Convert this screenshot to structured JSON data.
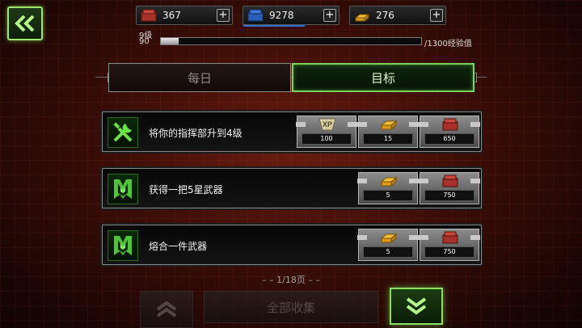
{
  "resources": [
    {
      "name": "red-crate",
      "value": "367",
      "color": "#c0392b"
    },
    {
      "name": "blue-crate",
      "value": "9278",
      "color": "#2e6fd6"
    },
    {
      "name": "gold-bars",
      "value": "276",
      "color": "#e3a41a"
    }
  ],
  "player": {
    "level_label": "9级",
    "xp_current": "90",
    "xp_max_label": "/1300经验值",
    "xp_progress": 0.069
  },
  "tabs": [
    {
      "label": "每日",
      "active": false
    },
    {
      "label": "目标",
      "active": true
    }
  ],
  "quests": [
    {
      "title": "将你的指挥部升到4级",
      "icon": "wrench-screwdriver-icon",
      "rewards": [
        {
          "type": "xp",
          "label": "XP",
          "value": "100"
        },
        {
          "type": "gold",
          "value": "15"
        },
        {
          "type": "red-crate",
          "value": "650"
        }
      ]
    },
    {
      "title": "获得一把5星武器",
      "icon": "medal-icon",
      "rewards": [
        {
          "type": "gold",
          "value": "5"
        },
        {
          "type": "red-crate",
          "value": "750"
        }
      ]
    },
    {
      "title": "熔合一件武器",
      "icon": "medal-icon",
      "rewards": [
        {
          "type": "gold",
          "value": "5"
        },
        {
          "type": "red-crate",
          "value": "750"
        }
      ]
    }
  ],
  "pager": "– – 1/18页 – –",
  "collect_all_label": "全部收集",
  "colors": {
    "accent_green": "#8ce05f",
    "xp_bar_blue": "#2d6fcf"
  }
}
